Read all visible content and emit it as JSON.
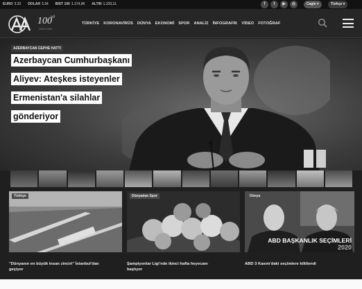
{
  "ticker": {
    "items": [
      {
        "label": "EURO",
        "value": "3.33"
      },
      {
        "label": "DOLAR",
        "value": "3.34"
      },
      {
        "label": "BIST 100",
        "value": "1.174,06"
      },
      {
        "label": "ALTIN",
        "value": "1.233,11"
      }
    ],
    "social": [
      "f",
      "t",
      "▶",
      "◎"
    ],
    "language": "Cagle ▾",
    "region": "Türkçe ▾"
  },
  "header": {
    "logo_text": "AA",
    "logo_anniversary": "100",
    "logo_yil": "yıl",
    "logo_sub": "1920-2020",
    "nav": [
      "TÜRKİYE",
      "KORONAVİRÜS",
      "DÜNYA",
      "EKONOMİ",
      "SPOR",
      "ANALİZ",
      "İNFOGRAFİK",
      "VİDEO",
      "FOTOĞRAF"
    ]
  },
  "hero": {
    "tag": "AZERBAYCAN CEPHE HATTI",
    "headline_lines": [
      "Azerbaycan Cumhurbaşkanı",
      "Aliyev: Ateşkes isteyenler",
      "Ermenistan'a silahlar",
      "gönderiyor"
    ]
  },
  "cards": [
    {
      "tag": "Türkiye",
      "title_lines": [
        "\"Dünyanın en büyük insan zinciri\" İstanbul'dan",
        "geçiyor"
      ]
    },
    {
      "tag": "Dünyadan Spor",
      "title_lines": [
        "Şampiyonlar Ligi'nde ikinci hafta heyecanı",
        "başlıyor"
      ]
    },
    {
      "tag": "Dünya",
      "overlay": "ABD BAŞKANLIK SEÇİMLERİ",
      "overlay_year": "2020",
      "title_lines": [
        "ABD 3 Kasım'daki seçimlere kilitlendi",
        ""
      ]
    }
  ],
  "colors": {
    "page_bg": "#1f1f1f",
    "headline_bg": "#ffffff",
    "tag_bg": "#3a3a3a"
  }
}
